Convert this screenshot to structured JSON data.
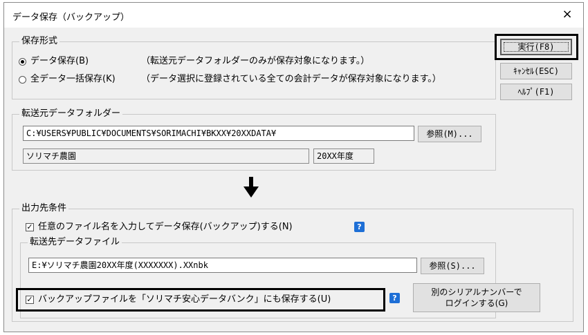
{
  "window": {
    "title": "データ保存（バックアップ）",
    "close": "×"
  },
  "format_group": {
    "label": "保存形式",
    "option1": {
      "label": "データ保存(B)",
      "note": "（転送元データフォルダーのみが保存対象になります。）",
      "selected": true
    },
    "option2": {
      "label": "全データ一括保存(K)",
      "note": "（データ選択に登録されている全ての会計データが保存対象になります。）",
      "selected": false
    }
  },
  "buttons": {
    "run": "実行(F8)",
    "cancel": "ｷｬﾝｾﾙ(ESC)",
    "help": "ﾍﾙﾌﾟ(F1)"
  },
  "source_group": {
    "label": "転送元データフォルダー",
    "path": "C:¥USERS¥PUBLIC¥DOCUMENTS¥SORIMACHI¥BKXX¥20XXDATA¥",
    "browse": "参照(M)...",
    "company": "ソリマチ農園",
    "year": "20XX年度"
  },
  "output_group": {
    "label": "出力先条件",
    "custom_name": {
      "label": "任意のファイル名を入力してデータ保存(バックアップ)する(N)",
      "checked": true
    },
    "dest_group": {
      "label": "転送先データファイル",
      "path": "E:¥ソリマチ農園20XX年度(XXXXXXX).XXnbk",
      "browse": "参照(S)..."
    },
    "bank": {
      "label": "バックアップファイルを「ソリマチ安心データバンク」にも保存する(U)",
      "checked": true
    },
    "login": {
      "line1": "別のシリアルナンバーで",
      "line2": "ログインする(G)"
    }
  },
  "help_icon": "?"
}
